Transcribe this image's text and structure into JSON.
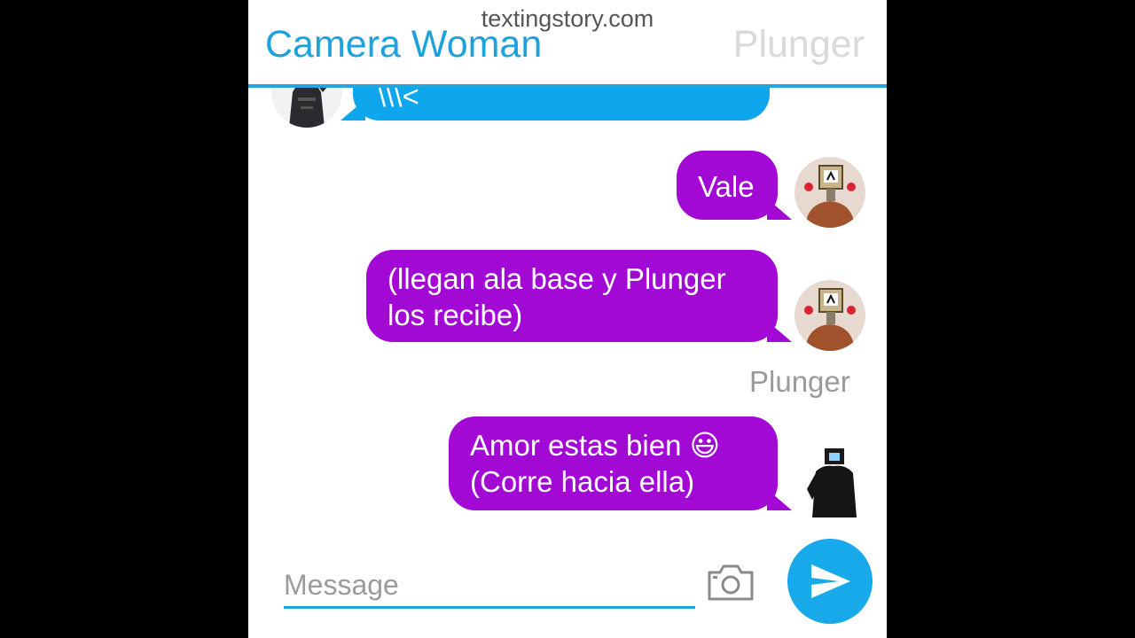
{
  "watermark": "textingstory.com",
  "header": {
    "contact_name": "Camera Woman",
    "other_name": "Plunger"
  },
  "messages": [
    {
      "sender": "Camera Woman",
      "side": "left",
      "color": "#0ea6ec",
      "text": "\\\\\\<"
    },
    {
      "sender": "Plunger",
      "side": "right",
      "color": "#a209d5",
      "text": "Vale"
    },
    {
      "sender": "Plunger",
      "side": "right",
      "color": "#a209d5",
      "lines": [
        "(llegan ala base y Plunger",
        "los recibe)"
      ]
    },
    {
      "sender": "Plunger",
      "side": "right",
      "color": "#a209d5",
      "lines": [
        "Amor estas bien 😃",
        "(Corre hacia ella)"
      ]
    }
  ],
  "sender_label": "Plunger",
  "composer": {
    "placeholder": "Message",
    "value": ""
  },
  "icons": {
    "camera": "camera-icon",
    "send": "send-icon"
  },
  "colors": {
    "accent": "#1ea2db",
    "bubble_blue": "#0ea6ec",
    "bubble_purple": "#a209d5"
  }
}
